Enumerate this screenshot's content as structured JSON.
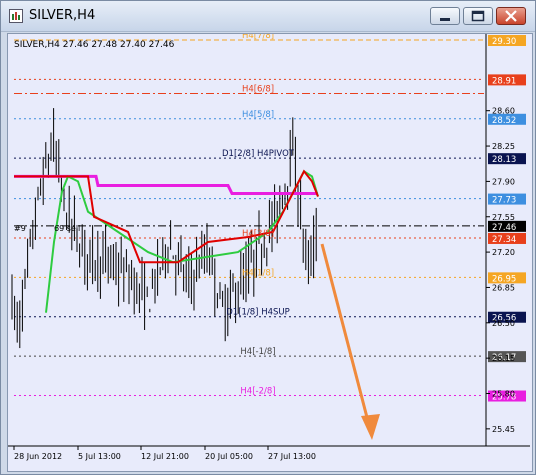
{
  "window": {
    "title": "SILVER,H4",
    "icons": [
      "chart-window-icon",
      "minimize-icon",
      "maximize-icon",
      "close-icon"
    ]
  },
  "chart_data": {
    "type": "candlestick",
    "instrument_line": "SILVER,H4  27.46 27.48 27.40 27.46",
    "ylim": [
      25.3,
      29.3
    ],
    "y_ticks": [
      "28.60",
      "28.25",
      "27.90",
      "27.55",
      "27.20",
      "26.85",
      "26.50",
      "26.15",
      "25.80",
      "25.45"
    ],
    "x_ticks": [
      "28 Jun 2012",
      "5 Jul 13:00",
      "12 Jul 21:00",
      "20 Jul 05:00",
      "27 Jul 13:00"
    ],
    "levels": [
      {
        "label": "H4[7/8]",
        "price": "29.30",
        "value": 29.3,
        "color": "#f5a623",
        "style": "dash"
      },
      {
        "label": "",
        "price": "28.91",
        "value": 28.91,
        "color": "#e8401c",
        "style": "dot"
      },
      {
        "label": "H4[6/8]",
        "price": "",
        "value": 28.77,
        "color": "#e8401c",
        "style": "dashdot"
      },
      {
        "label": "H4[5/8]",
        "price": "28.52",
        "value": 28.52,
        "color": "#3d8fe0",
        "style": "dot"
      },
      {
        "label": "D1[2/8] H4PIVOT",
        "price": "28.13",
        "value": 28.13,
        "color": "#0a1450",
        "style": "dot"
      },
      {
        "label": "",
        "price": "27.73",
        "value": 27.73,
        "color": "#3d8fe0",
        "style": "dot"
      },
      {
        "label": "",
        "price": "27.46",
        "value": 27.46,
        "color": "#000000",
        "style": "dashdot"
      },
      {
        "label": "H4[3/8]",
        "price": "27.34",
        "value": 27.34,
        "color": "#e8401c",
        "style": "dot"
      },
      {
        "label": "H4[1/8]",
        "price": "26.95",
        "value": 26.95,
        "color": "#f5a623",
        "style": "dot"
      },
      {
        "label": "D1[1/8] H4SUP",
        "price": "26.56",
        "value": 26.56,
        "color": "#0a1450",
        "style": "dot"
      },
      {
        "label": "H4[-1/8]",
        "price": "26.17",
        "value": 26.17,
        "color": "#444444",
        "style": "dot"
      },
      {
        "label": "H4[-2/8]",
        "price": "25.78",
        "value": 25.78,
        "color": "#e91ee0",
        "style": "dot"
      }
    ],
    "order_label": "#9",
    "order_tail": "69 sell",
    "magenta_line_color": "#e91ee0",
    "green_line_color": "#2ecc40",
    "red_line_color": "#e00000",
    "arrow_color": "#f08a3c"
  }
}
